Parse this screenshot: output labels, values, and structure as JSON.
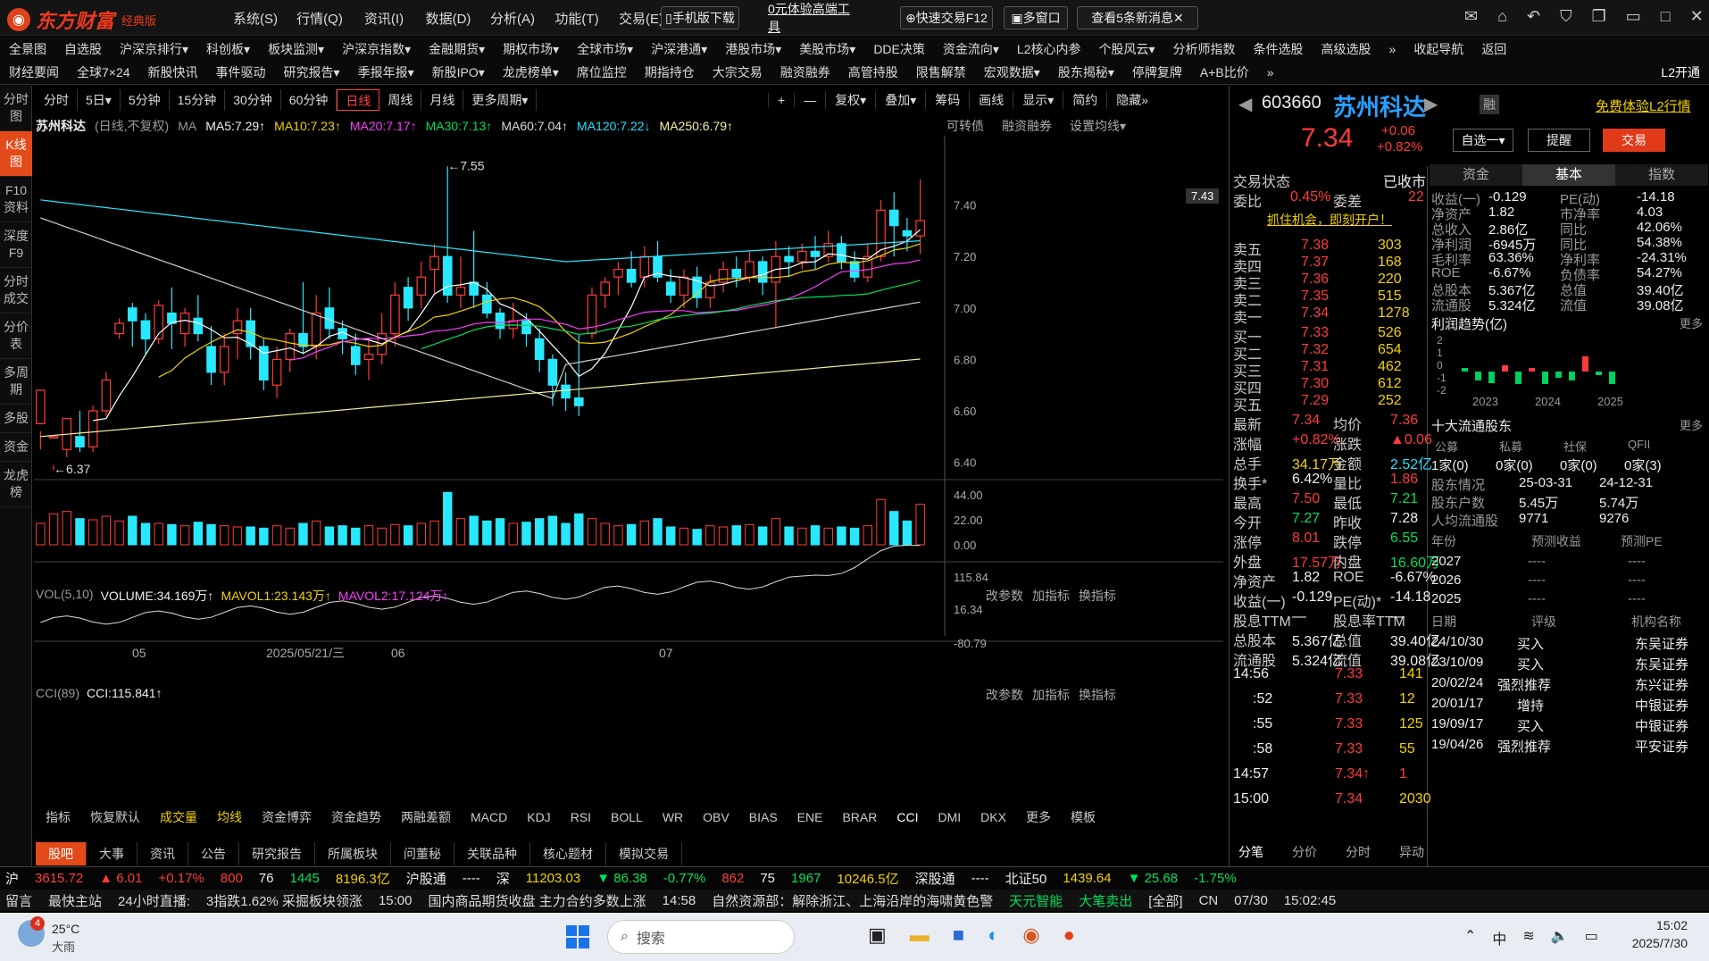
{
  "app": {
    "brand": "东方财富",
    "edition": "经典版",
    "menu": [
      "系统(S)",
      "行情(Q)",
      "资讯(I)",
      "数据(D)",
      "分析(A)",
      "功能(T)",
      "交易(E)",
      "帮助(H)"
    ],
    "mobile": "手机版下载",
    "promo": "0元体验高端工具",
    "quick_trade": "快速交易F12",
    "multi_window": "多窗口",
    "news_btn": "查看5条新消息",
    "mail_badge": "5"
  },
  "nav1": [
    "全景图",
    "自选股",
    "沪深京排行▾",
    "科创板▾",
    "板块监测▾",
    "沪深京指数▾",
    "金融期货▾",
    "期权市场▾",
    "全球市场▾",
    "沪深港通▾",
    "港股市场▾",
    "美股市场▾",
    "DDE决策",
    "资金流向▾",
    "L2核心内参",
    "个股风云▾",
    "分析师指数",
    "条件选股",
    "高级选股",
    "»",
    "收起导航",
    "返回"
  ],
  "nav2": [
    "财经要闻",
    "全球7×24",
    "新股快讯",
    "事件驱动",
    "研究报告▾",
    "季报年报▾",
    "新股IPO▾",
    "龙虎榜单▾",
    "席位监控",
    "期指持仓",
    "大宗交易",
    "融资融券",
    "高管持股",
    "限售解禁",
    "宏观数据▾",
    "股东揭秘▾",
    "停牌复牌",
    "A+B比价",
    "»",
    "L2开通"
  ],
  "leftrail": [
    "分时图",
    "K线图",
    "F10资料",
    "深度F9",
    "分时成交",
    "分价表",
    "多周期",
    "多股",
    "资金",
    "龙虎榜"
  ],
  "periods": [
    "分时",
    "5日▾",
    "5分钟",
    "15分钟",
    "30分钟",
    "60分钟",
    "日线",
    "周线",
    "月线",
    "更多周期▾"
  ],
  "period_tools": [
    "+",
    "—",
    "复权▾",
    "叠加▾",
    "筹码",
    "画线",
    "显示▾",
    "简约",
    "隐藏»"
  ],
  "ma": {
    "stock": "苏州科达",
    "mode": "(日线,不复权)",
    "label": "MA",
    "ma5": "MA5:7.29↑",
    "ma10": "MA10:7.23↑",
    "ma20": "MA20:7.17↑",
    "ma30": "MA30:7.13↑",
    "ma60": "MA60:7.04↑",
    "ma120": "MA120:7.22↓",
    "ma250": "MA250:6.79↑",
    "links": [
      "可转债",
      "融资融券",
      "设置均线▾"
    ]
  },
  "chart_labels": {
    "high": "←7.55",
    "low": "←6.37",
    "price_tag": "7.43"
  },
  "y_axis": [
    "7.40",
    "7.20",
    "7.00",
    "6.80",
    "6.60",
    "6.40"
  ],
  "vol": {
    "label": "VOL(5,10)",
    "volume": "VOLUME:34.169万↑",
    "mavol1": "MAVOL1:23.143万↑",
    "mavol2": "MAVOL2:17.124万↑",
    "y": [
      "44.00",
      "22.00",
      "0.00"
    ],
    "tools": [
      "改参数",
      "加指标",
      "换指标"
    ]
  },
  "cci": {
    "label": "CCI(89)",
    "value": "CCI:115.841↑",
    "y": [
      "115.84",
      "16.34",
      "-80.79"
    ]
  },
  "x_axis": [
    "05",
    "2025/05/21/三",
    "06",
    "07"
  ],
  "indicators": [
    "指标",
    "恢复默认",
    "成交量",
    "均线",
    "资金博弈",
    "资金趋势",
    "两融差额",
    "MACD",
    "KDJ",
    "RSI",
    "BOLL",
    "WR",
    "OBV",
    "BIAS",
    "ENE",
    "BRAR",
    "CCI",
    "DMI",
    "DKX",
    "更多",
    "模板"
  ],
  "bottomtabs": [
    "股吧",
    "大事",
    "资讯",
    "公告",
    "研究报告",
    "所属板块",
    "问董秘",
    "关联品种",
    "核心题材",
    "模拟交易"
  ],
  "stock": {
    "code": "603660",
    "name": "苏州科达",
    "price": "7.34",
    "chg": "+0.06",
    "pct": "+0.82%",
    "buttons": [
      "自选一▾",
      "提醒",
      "交易"
    ],
    "l2": "免费体验L2行情"
  },
  "trade_state": {
    "label": "交易状态",
    "value": "已收市",
    "wb_label": "委比",
    "wb": "0.45%",
    "wc_label": "委差",
    "wc": "22",
    "promo": "抓住机会，即刻开户！"
  },
  "asks": [
    [
      "卖五",
      "7.38",
      "303"
    ],
    [
      "卖四",
      "7.37",
      "168"
    ],
    [
      "卖三",
      "7.36",
      "220"
    ],
    [
      "卖二",
      "7.35",
      "515"
    ],
    [
      "卖一",
      "7.34",
      "1278"
    ]
  ],
  "bids": [
    [
      "买一",
      "7.33",
      "526"
    ],
    [
      "买二",
      "7.32",
      "654"
    ],
    [
      "买三",
      "7.31",
      "462"
    ],
    [
      "买四",
      "7.30",
      "612"
    ],
    [
      "买五",
      "7.29",
      "252"
    ]
  ],
  "stats": [
    [
      "最新",
      "7.34",
      "均价",
      "7.36"
    ],
    [
      "涨幅",
      "+0.82%",
      "涨跌",
      "▲0.06"
    ],
    [
      "总手",
      "34.17万",
      "金额",
      "2.52亿"
    ],
    [
      "换手*",
      "6.42%",
      "量比",
      "1.86"
    ],
    [
      "最高",
      "7.50",
      "最低",
      "7.21"
    ],
    [
      "今开",
      "7.27",
      "昨收",
      "7.28"
    ],
    [
      "涨停",
      "8.01",
      "跌停",
      "6.55"
    ],
    [
      "外盘",
      "17.57万",
      "内盘",
      "16.60万"
    ],
    [
      "净资产",
      "1.82",
      "ROE",
      "-6.67%"
    ],
    [
      "收益(一)",
      "-0.129",
      "PE(动)*",
      "-14.18"
    ],
    [
      "股息TTM",
      "—",
      "股息率TTM",
      "—"
    ],
    [
      "总股本",
      "5.367亿",
      "总值",
      "39.40亿"
    ],
    [
      "流通股",
      "5.324亿",
      "流值",
      "39.08亿"
    ]
  ],
  "ticks": [
    [
      "14:56",
      "7.33",
      "141"
    ],
    [
      ":52",
      "7.33",
      "12"
    ],
    [
      ":55",
      "7.33",
      "125"
    ],
    [
      ":58",
      "7.33",
      "55"
    ],
    [
      "14:57",
      "7.34↑",
      "1"
    ],
    [
      "15:00",
      "7.34",
      "2030"
    ]
  ],
  "tick_tabs": [
    "分笔",
    "分价",
    "分时",
    "异动"
  ],
  "fin_tabs": [
    "资金",
    "基本",
    "指数"
  ],
  "fin": [
    [
      "收益(一)",
      "-0.129",
      "PE(动)",
      "-14.18"
    ],
    [
      "净资产",
      "1.82",
      "市净率",
      "4.03"
    ],
    [
      "总收入",
      "2.86亿",
      "同比",
      "42.06%"
    ],
    [
      "净利润",
      "-6945万",
      "同比",
      "54.38%"
    ],
    [
      "毛利率",
      "63.36%",
      "净利率",
      "-24.31%"
    ],
    [
      "ROE",
      "-6.67%",
      "负债率",
      "54.27%"
    ],
    [
      "总股本",
      "5.367亿",
      "总值",
      "39.40亿"
    ],
    [
      "流通股",
      "5.324亿",
      "流值",
      "39.08亿"
    ]
  ],
  "profit": {
    "title": "利润趋势(亿)",
    "more": "更多",
    "years": [
      "2023",
      "2024",
      "2025"
    ],
    "y": [
      "2",
      "1",
      "0",
      "-1",
      "-2"
    ]
  },
  "holders": {
    "title": "十大流通股东",
    "more": "更多",
    "cols": [
      "公募",
      "私募",
      "社保",
      "QFII"
    ],
    "vals": [
      "1家(0)",
      "0家(0)",
      "0家(0)",
      "0家(3)"
    ],
    "rows": [
      [
        "股东情况",
        "25-03-31",
        "24-12-31"
      ],
      [
        "股东户数",
        "5.45万",
        "5.74万"
      ],
      [
        "人均流通股",
        "9771",
        "9276"
      ]
    ]
  },
  "forecast": {
    "cols": [
      "年份",
      "预测收益",
      "预测PE"
    ],
    "rows": [
      [
        "2027",
        "----",
        "----"
      ],
      [
        "2026",
        "----",
        "----"
      ],
      [
        "2025",
        "----",
        "----"
      ]
    ]
  },
  "ratings": {
    "cols": [
      "日期",
      "评级",
      "机构名称"
    ],
    "rows": [
      [
        "24/10/30",
        "买入",
        "东吴证券"
      ],
      [
        "23/10/09",
        "买入",
        "东吴证券"
      ],
      [
        "20/02/24",
        "强烈推荐",
        "东兴证券"
      ],
      [
        "20/01/17",
        "增持",
        "中银证券"
      ],
      [
        "19/09/17",
        "买入",
        "中银证券"
      ],
      [
        "19/04/26",
        "强烈推荐",
        "平安证券"
      ]
    ]
  },
  "indexbar": {
    "sh": [
      "沪",
      "3615.72",
      "▲ 6.01",
      "+0.17%",
      "800",
      "76",
      "1445",
      "8196.3亿",
      "沪股通",
      "----"
    ],
    "sz": [
      "深",
      "11203.03",
      "▼ 86.38",
      "-0.77%",
      "862",
      "75",
      "1967",
      "10246.5亿",
      "深股通",
      "----"
    ],
    "bz": [
      "北证50",
      "1439.64",
      "▼ 25.68",
      "-1.75%"
    ]
  },
  "newsbar": [
    "留言",
    "最快主站",
    "24小时直播:",
    "3指跌1.62% 采掘板块领涨",
    "15:00",
    "国内商品期货收盘 主力合约多数上涨",
    "14:58",
    "自然资源部：解除浙江、上海沿岸的海啸黄色警",
    "天元智能",
    "大笔卖出",
    "[全部]",
    "CN",
    "07/30",
    "15:02:45"
  ],
  "taskbar": {
    "temp": "25°C",
    "weather": "大雨",
    "badge": "4",
    "search": "搜索",
    "time": "15:02",
    "date": "2025/7/30",
    "ime": "中"
  },
  "chart_data": {
    "type": "candlestick",
    "title": "苏州科达 (日线,不复权)",
    "ylim": [
      6.35,
      7.6
    ],
    "candles": [
      [
        6.55,
        6.68,
        6.52,
        6.45
      ],
      [
        6.5,
        6.5,
        6.39,
        6.37
      ],
      [
        6.45,
        6.57,
        6.55,
        6.42
      ],
      [
        6.5,
        6.46,
        6.6,
        6.44
      ],
      [
        6.46,
        6.6,
        6.62,
        6.44
      ],
      [
        6.6,
        6.72,
        6.75,
        6.58
      ],
      [
        6.9,
        6.94,
        6.96,
        6.88
      ],
      [
        7.0,
        6.95,
        7.02,
        6.85
      ],
      [
        6.95,
        6.88,
        6.98,
        6.82
      ],
      [
        6.88,
        7.01,
        7.03,
        6.86
      ],
      [
        6.98,
        6.94,
        7.08,
        6.84
      ],
      [
        6.9,
        6.98,
        7.0,
        6.85
      ],
      [
        6.96,
        6.9,
        7.05,
        6.87
      ],
      [
        6.85,
        6.75,
        6.93,
        6.7
      ],
      [
        6.75,
        6.85,
        6.9,
        6.7
      ],
      [
        6.9,
        6.95,
        7.0,
        6.8
      ],
      [
        6.95,
        6.85,
        7.0,
        6.8
      ],
      [
        6.85,
        6.72,
        6.88,
        6.68
      ],
      [
        6.7,
        6.8,
        6.85,
        6.65
      ],
      [
        6.8,
        6.9,
        6.92,
        6.75
      ],
      [
        6.9,
        6.85,
        7.1,
        6.82
      ],
      [
        6.85,
        6.98,
        7.05,
        6.8
      ],
      [
        7.0,
        6.92,
        7.08,
        6.88
      ],
      [
        6.92,
        6.88,
        6.95,
        6.82
      ],
      [
        6.85,
        6.78,
        6.9,
        6.74
      ],
      [
        6.8,
        6.82,
        6.88,
        6.72
      ],
      [
        6.82,
        6.9,
        6.98,
        6.78
      ],
      [
        6.9,
        7.05,
        7.1,
        6.85
      ],
      [
        7.08,
        7.0,
        7.12,
        6.95
      ],
      [
        7.05,
        7.12,
        7.18,
        7.0
      ],
      [
        7.15,
        7.2,
        7.25,
        7.05
      ],
      [
        7.2,
        7.05,
        7.55,
        7.02
      ],
      [
        7.05,
        7.08,
        7.2,
        7.0
      ],
      [
        7.1,
        7.05,
        7.3,
        7.0
      ],
      [
        7.05,
        6.98,
        7.1,
        6.96
      ],
      [
        6.98,
        6.92,
        7.0,
        6.88
      ],
      [
        6.92,
        6.95,
        7.02,
        6.88
      ],
      [
        6.95,
        6.9,
        6.98,
        6.85
      ],
      [
        6.88,
        6.8,
        6.92,
        6.75
      ],
      [
        6.8,
        6.7,
        6.82,
        6.62
      ],
      [
        6.7,
        6.65,
        6.75,
        6.6
      ],
      [
        6.65,
        6.62,
        6.9,
        6.58
      ],
      [
        6.9,
        7.05,
        7.08,
        6.88
      ],
      [
        7.05,
        7.1,
        7.12,
        7.0
      ],
      [
        7.12,
        7.15,
        7.18,
        7.05
      ],
      [
        7.15,
        7.1,
        7.22,
        7.08
      ],
      [
        7.12,
        7.2,
        7.24,
        7.08
      ],
      [
        7.2,
        7.12,
        7.26,
        7.1
      ],
      [
        7.1,
        7.05,
        7.15,
        7.02
      ],
      [
        7.05,
        7.12,
        7.15,
        7.0
      ],
      [
        7.12,
        7.04,
        7.16,
        7.0
      ],
      [
        7.04,
        7.1,
        7.13,
        7.0
      ],
      [
        7.1,
        7.15,
        7.18,
        7.06
      ],
      [
        7.15,
        7.12,
        7.2,
        7.08
      ],
      [
        7.12,
        7.18,
        7.22,
        7.1
      ],
      [
        7.18,
        7.1,
        7.2,
        7.05
      ],
      [
        7.1,
        7.2,
        7.26,
        6.92
      ],
      [
        7.2,
        7.18,
        7.24,
        7.12
      ],
      [
        7.18,
        7.22,
        7.25,
        7.15
      ],
      [
        7.22,
        7.2,
        7.28,
        7.15
      ],
      [
        7.2,
        7.25,
        7.3,
        7.18
      ],
      [
        7.25,
        7.18,
        7.28,
        7.15
      ],
      [
        7.18,
        7.12,
        7.22,
        7.1
      ],
      [
        7.12,
        7.2,
        7.25,
        7.1
      ],
      [
        7.2,
        7.38,
        7.42,
        7.18
      ],
      [
        7.38,
        7.32,
        7.45,
        7.2
      ],
      [
        7.3,
        7.28,
        7.35,
        7.22
      ],
      [
        7.28,
        7.34,
        7.5,
        7.21
      ]
    ]
  }
}
